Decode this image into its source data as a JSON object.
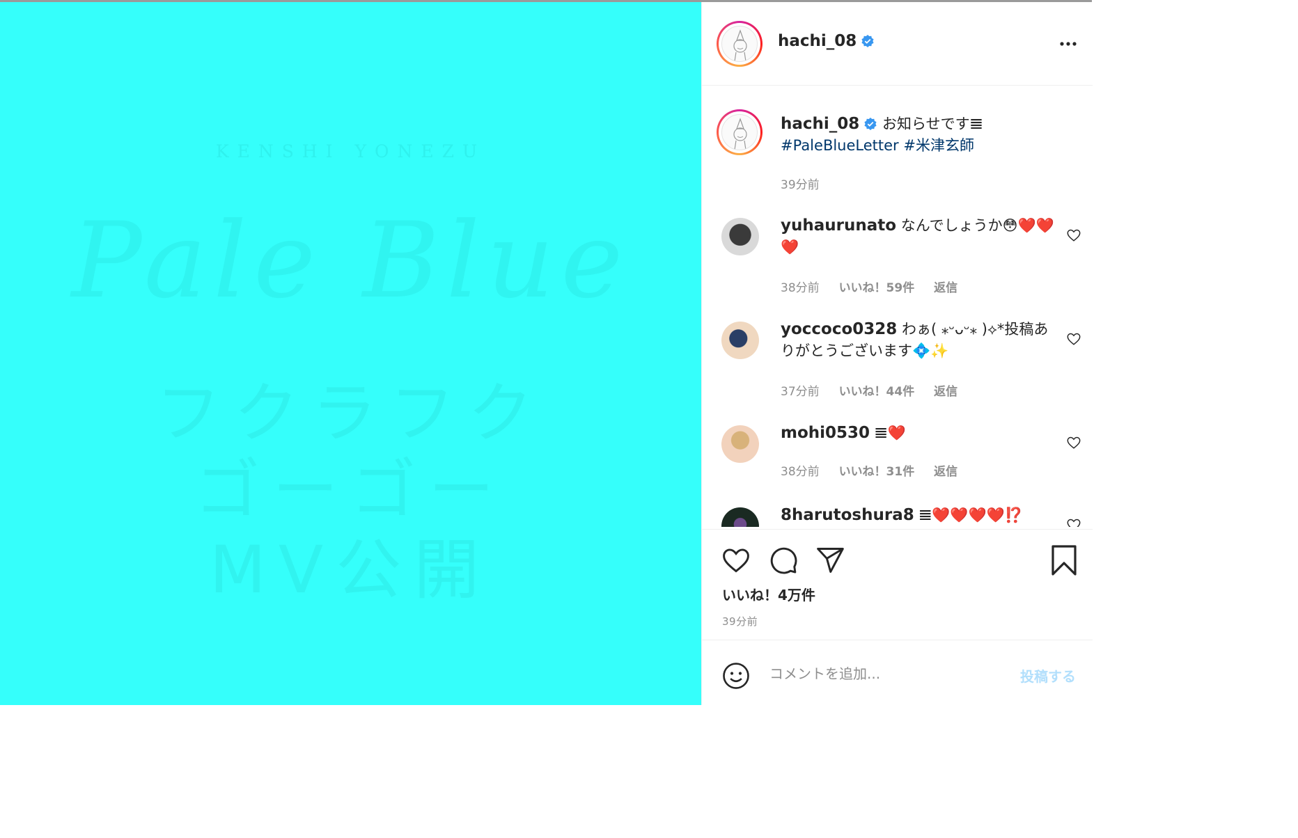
{
  "post": {
    "username": "hachi_08",
    "caption_text": "お知らせです",
    "caption_emoji": "𝌆",
    "hashtags": [
      "#PaleBlueLetter",
      "#米津玄師"
    ],
    "caption_time": "39分前",
    "likes_label": "いいね！4万件",
    "post_time": "39分前"
  },
  "media": {
    "background": "#35fffb",
    "ghost_caps": "KENSHI YONEZU",
    "ghost_script": "Pale Blue",
    "ghost_lines": [
      "フクラフク",
      "ゴーゴー",
      "MV公開"
    ]
  },
  "header": {
    "more_icon": "more-horizontal-icon"
  },
  "comments": [
    {
      "username": "yuhaurunato",
      "text": "なんでしょうか😳❤️❤️❤️",
      "time": "38分前",
      "likes": "いいね！59件",
      "reply": "返信"
    },
    {
      "username": "yoccoco0328",
      "text": "わぁ( ⁎ᵕᴗᵕ⁎ )⟡*投稿ありがとうございます💠✨",
      "time": "37分前",
      "likes": "いいね！44件",
      "reply": "返信"
    },
    {
      "username": "mohi0530",
      "text": "𝌆❤️",
      "time": "38分前",
      "likes": "いいね！31件",
      "reply": "返信"
    },
    {
      "username": "8harutoshura8",
      "text": "𝌆❤️❤️❤️❤️⁉️",
      "time": "",
      "likes": "",
      "reply": ""
    }
  ],
  "add_comment": {
    "placeholder": "コメントを追加...",
    "post_button": "投稿する"
  },
  "colors": {
    "accent_blue": "#0095f6",
    "post_button_disabled": "#b2dffc",
    "hashtag": "#00376b"
  }
}
